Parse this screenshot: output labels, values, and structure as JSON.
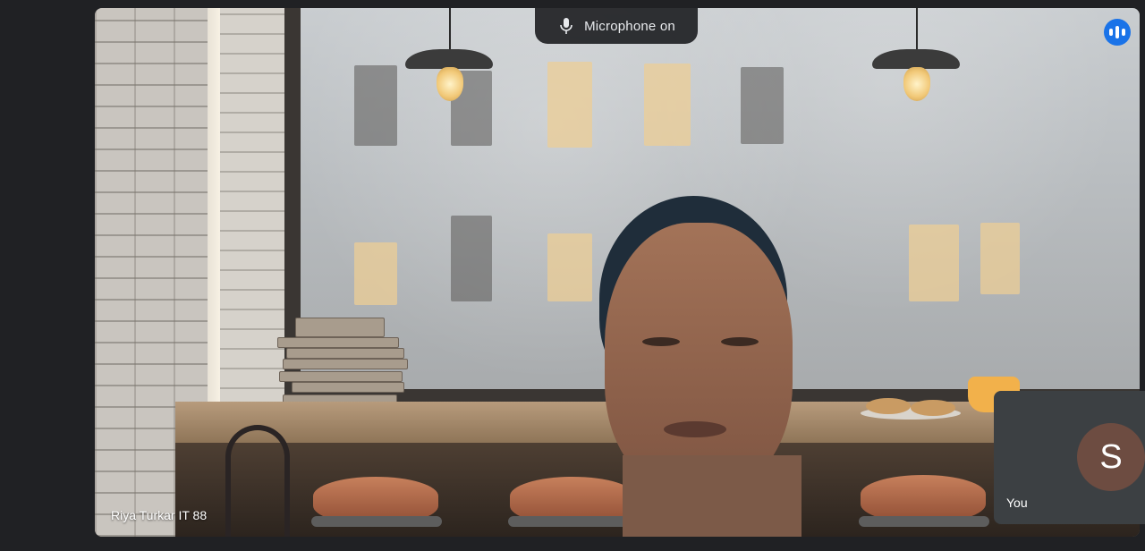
{
  "meeting": {
    "mic_status": "Microphone on",
    "mic_icon": "microphone-icon",
    "speaking_icon": "speaking-indicator-icon"
  },
  "main_participant": {
    "name": "Riya Turkar IT 88"
  },
  "self_view": {
    "label": "You",
    "initial": "S",
    "avatar_color": "#6d4c41"
  },
  "colors": {
    "background": "#202124",
    "accent": "#1a73e8",
    "tile": "#3c4043"
  }
}
